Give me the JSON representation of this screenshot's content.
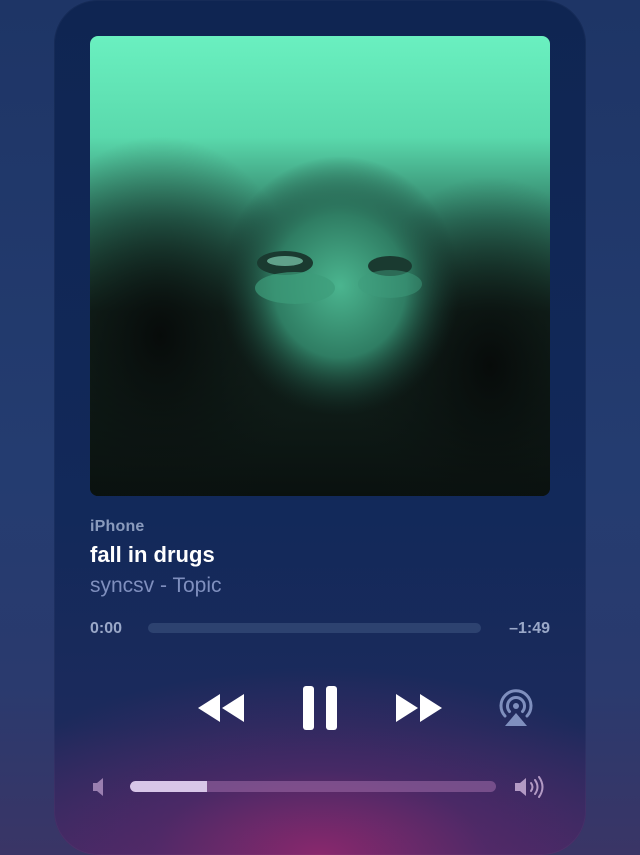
{
  "now_playing": {
    "device": "iPhone",
    "title": "fall in drugs",
    "artist": "syncsv - Topic"
  },
  "progress": {
    "elapsed": "0:00",
    "remaining": "–1:49",
    "fraction": 0
  },
  "controls": {
    "rewind_icon": "rewind-icon",
    "pause_icon": "pause-icon",
    "forward_icon": "fast-forward-icon",
    "airplay_icon": "airplay-icon"
  },
  "volume": {
    "level": 0.21,
    "min_icon": "speaker-low-icon",
    "max_icon": "speaker-high-icon"
  },
  "colors": {
    "accent_text": "#ffffff",
    "secondary_text": "#7f8fbe",
    "artwork_green": "#5fe3b0"
  }
}
